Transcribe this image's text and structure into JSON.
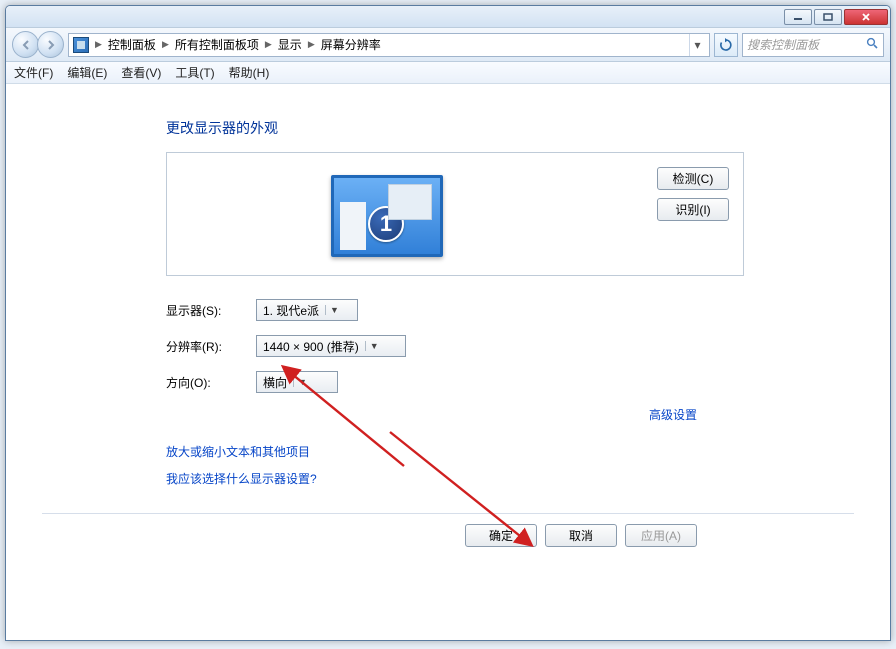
{
  "breadcrumb": {
    "items": [
      "控制面板",
      "所有控制面板项",
      "显示",
      "屏幕分辨率"
    ]
  },
  "search": {
    "placeholder": "搜索控制面板"
  },
  "menu": {
    "file": "文件(F)",
    "edit": "编辑(E)",
    "view": "查看(V)",
    "tools": "工具(T)",
    "help": "帮助(H)"
  },
  "heading": "更改显示器的外观",
  "preview": {
    "detect": "检测(C)",
    "identify": "识别(I)",
    "monitor_number": "1"
  },
  "form": {
    "display_label": "显示器(S):",
    "display_value": "1. 现代e派",
    "resolution_label": "分辨率(R):",
    "resolution_value": "1440 × 900 (推荐)",
    "orientation_label": "方向(O):",
    "orientation_value": "横向"
  },
  "advanced": "高级设置",
  "links": {
    "zoom": "放大或缩小文本和其他项目",
    "which": "我应该选择什么显示器设置?"
  },
  "buttons": {
    "ok": "确定",
    "cancel": "取消",
    "apply": "应用(A)"
  }
}
